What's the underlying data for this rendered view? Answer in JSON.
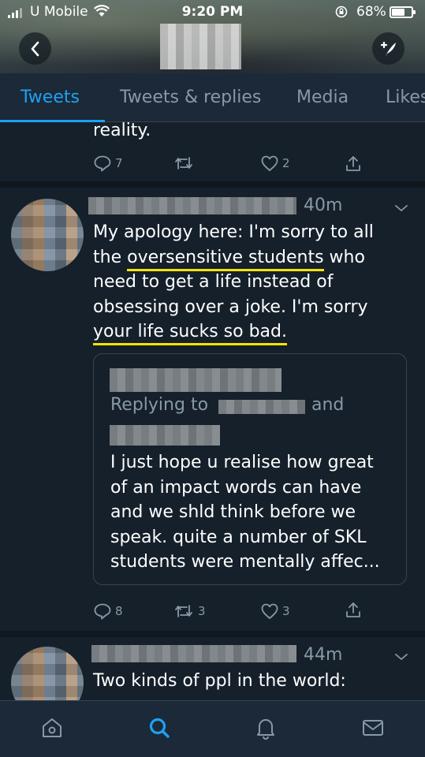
{
  "status_bar": {
    "carrier": "U Mobile",
    "time": "9:20 PM",
    "battery": "68%",
    "battery_level": 0.68
  },
  "header": {
    "back_icon": "chevron-left-icon",
    "compose_icon": "compose-tweet-icon"
  },
  "tabs": [
    {
      "label": "Tweets",
      "active": true
    },
    {
      "label": "Tweets & replies",
      "active": false
    },
    {
      "label": "Media",
      "active": false
    },
    {
      "label": "Likes",
      "active": false
    }
  ],
  "tweet_top": {
    "text": "reality.",
    "replies": "7",
    "retweets": "",
    "likes": "2"
  },
  "tweet_main": {
    "time": "40m",
    "text_line1": "My apology here: I'm sorry to all",
    "text_line2_pre": "the ",
    "text_line2_underlined": "oversensitive students",
    "text_line2_post": " who",
    "text_line3": "need to get a life instead of",
    "text_line4": "obsessing over a joke. I'm sorry",
    "text_line5_underlined": "your life sucks so bad.",
    "highlight_color": "#f5e400",
    "quote": {
      "replying_to": "Replying to",
      "and": "and",
      "text_line1": "I just hope u realise how great",
      "text_line2": "of an impact words can have",
      "text_line3": "and we shld think before we",
      "text_line4": "speak. quite a number of SKL",
      "text_line5": "students were mentally affec..."
    },
    "replies": "8",
    "retweets": "3",
    "likes": "3"
  },
  "tweet_bottom": {
    "time": "44m",
    "text_line1": "Two kinds of ppl in the world:"
  },
  "bottom_nav": [
    {
      "name": "home",
      "icon": "home-icon",
      "active": false
    },
    {
      "name": "search",
      "icon": "search-icon",
      "active": true
    },
    {
      "name": "notifications",
      "icon": "bell-icon",
      "active": false
    },
    {
      "name": "messages",
      "icon": "mail-icon",
      "active": false
    }
  ],
  "colors": {
    "background": "#15202b",
    "accent": "#1da1f2",
    "muted": "#8899a6",
    "border": "#38444d"
  }
}
